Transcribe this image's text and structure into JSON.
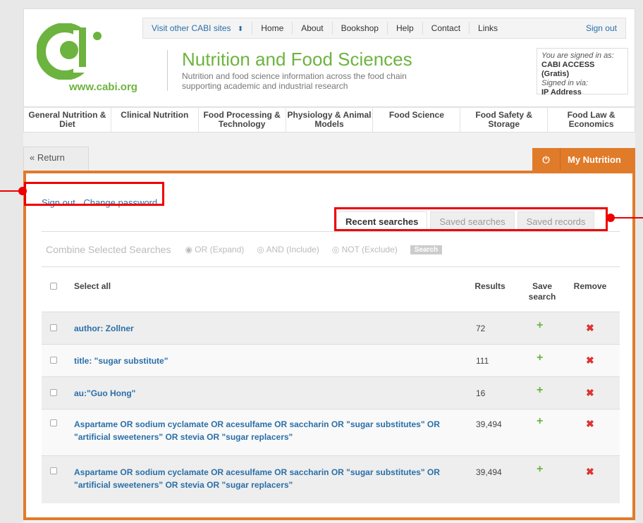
{
  "header": {
    "logo_text": "www.cabi.org",
    "title": "Nutrition and Food Sciences",
    "subtitle": "Nutrition and food science information across the food chain supporting academic and industrial research"
  },
  "topnav": {
    "visit": "Visit other CABI sites",
    "visit_chevron": "⬍",
    "items": [
      "Home",
      "About",
      "Bookshop",
      "Help",
      "Contact",
      "Links"
    ],
    "signout": "Sign out"
  },
  "signed_in": {
    "line1": "You are signed in as:",
    "name": "CABI ACCESS (Gratis)",
    "line3": "Signed in via:",
    "via": "IP Address"
  },
  "categories": [
    "General Nutrition & Diet",
    "Clinical Nutrition",
    "Food Processing & Technology",
    "Physiology & Animal Models",
    "Food Science",
    "Food Safety & Storage",
    "Food Law & Economics"
  ],
  "return_label": "« Return",
  "my_tab": {
    "icon": "power-icon",
    "label": "My Nutrition"
  },
  "account_links": {
    "signout": "Sign out",
    "change_password": "Change password"
  },
  "tabs": [
    "Recent searches",
    "Saved searches",
    "Saved records"
  ],
  "combine": {
    "label": "Combine Selected Searches",
    "options": [
      "OR (Expand)",
      "AND (Include)",
      "NOT (Exclude)"
    ],
    "button": "Search"
  },
  "table": {
    "headers": {
      "select_all": "Select all",
      "results": "Results",
      "save": "Save search",
      "remove": "Remove"
    },
    "rows": [
      {
        "query": "author: Zollner",
        "results": "72"
      },
      {
        "query": "title: \"sugar substitute\"",
        "results": "111"
      },
      {
        "query": "au:\"Guo Hong\"",
        "results": "16"
      },
      {
        "query": "Aspartame OR sodium cyclamate OR acesulfame OR saccharin OR \"sugar substitutes\" OR \"artificial sweeteners\" OR stevia OR \"sugar replacers\"",
        "results": "39,494"
      },
      {
        "query": "Aspartame OR sodium cyclamate OR acesulfame OR saccharin OR \"sugar substitutes\" OR \"artificial sweeteners\" OR stevia OR \"sugar replacers\"",
        "results": "39,494"
      }
    ]
  },
  "icons": {
    "save": "+",
    "remove": "✖"
  },
  "colors": {
    "accent": "#e07b2a",
    "brand_green": "#6db33f",
    "link": "#2a6fa8",
    "highlight": "#ee0000"
  }
}
